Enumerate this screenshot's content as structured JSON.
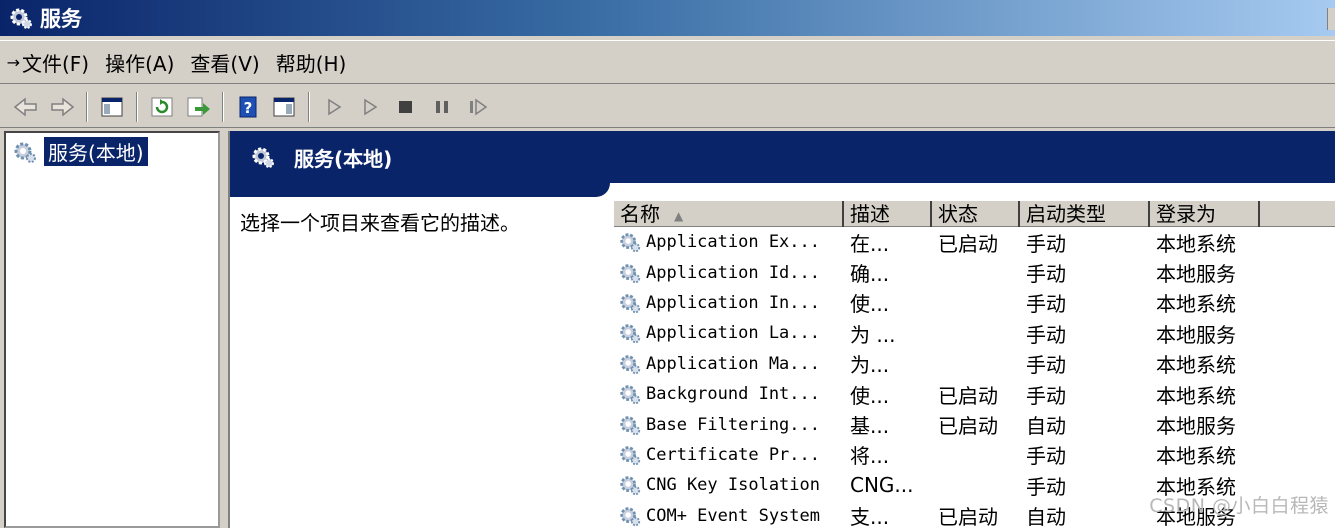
{
  "window": {
    "title": "服务",
    "icon": "gear-icon"
  },
  "menu": {
    "items": [
      "文件(F)",
      "操作(A)",
      "查看(V)",
      "帮助(H)"
    ]
  },
  "toolbar": {
    "buttons": [
      "back-icon",
      "forward-icon",
      "console-tree-icon",
      "refresh-icon",
      "export-icon",
      "help-icon",
      "properties-icon",
      "start-icon",
      "start-alt-icon",
      "stop-icon",
      "pause-icon",
      "resume-icon"
    ]
  },
  "tree": {
    "root_label": "服务(本地)"
  },
  "panel": {
    "header": "服务(本地)",
    "description_prompt": "选择一个项目来查看它的描述。"
  },
  "columns": {
    "name": "名称",
    "desc": "描述",
    "state": "状态",
    "startup": "启动类型",
    "logon": "登录为"
  },
  "services": [
    {
      "name": "Application Ex...",
      "desc": "在...",
      "state": "已启动",
      "startup": "手动",
      "logon": "本地系统"
    },
    {
      "name": "Application Id...",
      "desc": "确...",
      "state": "",
      "startup": "手动",
      "logon": "本地服务"
    },
    {
      "name": "Application In...",
      "desc": "使...",
      "state": "",
      "startup": "手动",
      "logon": "本地系统"
    },
    {
      "name": "Application La...",
      "desc": "为 ...",
      "state": "",
      "startup": "手动",
      "logon": "本地服务"
    },
    {
      "name": "Application Ma...",
      "desc": "为...",
      "state": "",
      "startup": "手动",
      "logon": "本地系统"
    },
    {
      "name": "Background Int...",
      "desc": "使...",
      "state": "已启动",
      "startup": "手动",
      "logon": "本地系统"
    },
    {
      "name": "Base Filtering...",
      "desc": "基...",
      "state": "已启动",
      "startup": "自动",
      "logon": "本地服务"
    },
    {
      "name": "Certificate Pr...",
      "desc": "将...",
      "state": "",
      "startup": "手动",
      "logon": "本地系统"
    },
    {
      "name": "CNG Key Isolation",
      "desc": "CNG...",
      "state": "",
      "startup": "手动",
      "logon": "本地系统"
    },
    {
      "name": "COM+ Event System",
      "desc": "支...",
      "state": "已启动",
      "startup": "自动",
      "logon": "本地服务"
    }
  ],
  "watermark": "CSDN @小白白程猿",
  "colors": {
    "title_bar": "#0a246a",
    "selection": "#0a246a",
    "chrome": "#d4d0c8"
  }
}
